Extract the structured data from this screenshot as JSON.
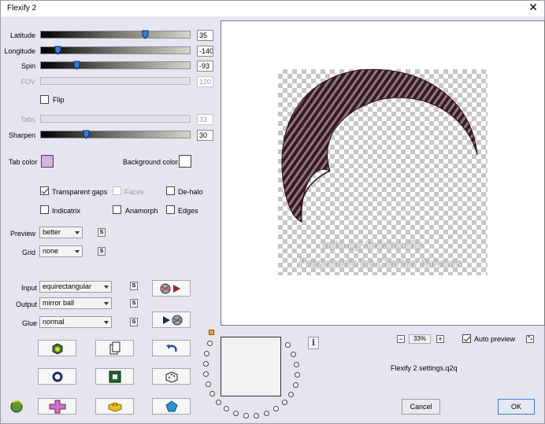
{
  "window": {
    "title": "Flexify 2",
    "close_glyph": "✕"
  },
  "sliders": [
    {
      "key": "latitude",
      "label": "Latitude",
      "value": "35",
      "level": 0.7,
      "disabled": false
    },
    {
      "key": "longitude",
      "label": "Longitude",
      "value": "-140",
      "level": 0.11,
      "disabled": false
    },
    {
      "key": "spin",
      "label": "Spin",
      "value": "-93",
      "level": 0.24,
      "disabled": false
    },
    {
      "key": "fov",
      "label": "FOV",
      "value": "120",
      "level": null,
      "disabled": true
    },
    {
      "key": "tabs",
      "label": "Tabs",
      "value": "33",
      "level": null,
      "disabled": true
    },
    {
      "key": "sharpen",
      "label": "Sharpen",
      "value": "30",
      "level": 0.3,
      "disabled": false
    }
  ],
  "flip": {
    "label": "Flip",
    "checked": false
  },
  "colors": {
    "tab_color_label": "Tab color",
    "tab_color": "#d8b0dc",
    "background_color_label": "Background color",
    "background_color": "#ffffff"
  },
  "options": {
    "transparent_gaps": {
      "label": "Transparent gaps",
      "checked": true
    },
    "faces": {
      "label": "Faces",
      "checked": false,
      "disabled": true
    },
    "de_halo": {
      "label": "De-halo",
      "checked": false
    },
    "indicatrix": {
      "label": "Indicatrix",
      "checked": false
    },
    "anamorph": {
      "label": "Anamorph",
      "checked": false
    },
    "edges": {
      "label": "Edges",
      "checked": false
    }
  },
  "preview": {
    "label": "Preview",
    "value": "better"
  },
  "grid": {
    "label": "Grid",
    "value": "none"
  },
  "s_button": "S",
  "input": {
    "label": "Input",
    "value": "equirectangular"
  },
  "output": {
    "label": "Output",
    "value": "mirror ball"
  },
  "glue": {
    "label": "Glue",
    "value": "normal"
  },
  "watermark": {
    "line1": "tuto by Suizabella",
    "line2": "Preparado by Clarisa Nóvoes"
  },
  "zoom": {
    "minus": "−",
    "value": "33%",
    "plus": "+"
  },
  "auto_preview": {
    "label": "Auto preview",
    "checked": true
  },
  "info_glyph": "i",
  "settings_file": "Flexify 2 settings.q2q",
  "buttons": {
    "cancel": "Cancel",
    "ok": "OK"
  },
  "accent_color": "#3a7bd5",
  "shape_color": "#3a1a22"
}
